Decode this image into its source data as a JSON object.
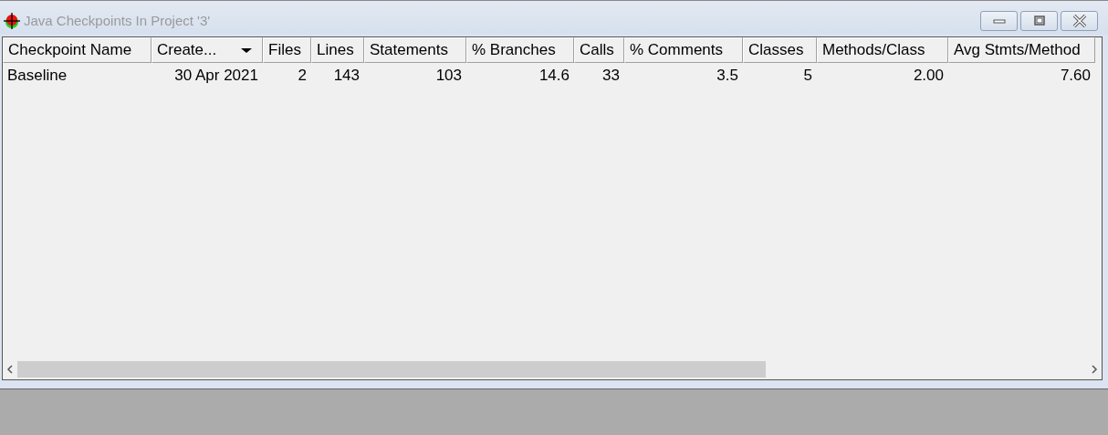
{
  "window": {
    "title": "Java Checkpoints In Project '3'"
  },
  "table": {
    "columns": [
      {
        "label": "Checkpoint Name",
        "sorted": false
      },
      {
        "label": "Create...",
        "sorted": true
      },
      {
        "label": "Files",
        "sorted": false
      },
      {
        "label": "Lines",
        "sorted": false
      },
      {
        "label": "Statements",
        "sorted": false
      },
      {
        "label": "% Branches",
        "sorted": false
      },
      {
        "label": "Calls",
        "sorted": false
      },
      {
        "label": "% Comments",
        "sorted": false
      },
      {
        "label": "Classes",
        "sorted": false
      },
      {
        "label": "Methods/Class",
        "sorted": false
      },
      {
        "label": "Avg Stmts/Method",
        "sorted": false
      }
    ],
    "rows": [
      {
        "cells": [
          "Baseline",
          "30 Apr 2021",
          "2",
          "143",
          "103",
          "14.6",
          "33",
          "3.5",
          "5",
          "2.00",
          "7.60"
        ]
      }
    ]
  }
}
